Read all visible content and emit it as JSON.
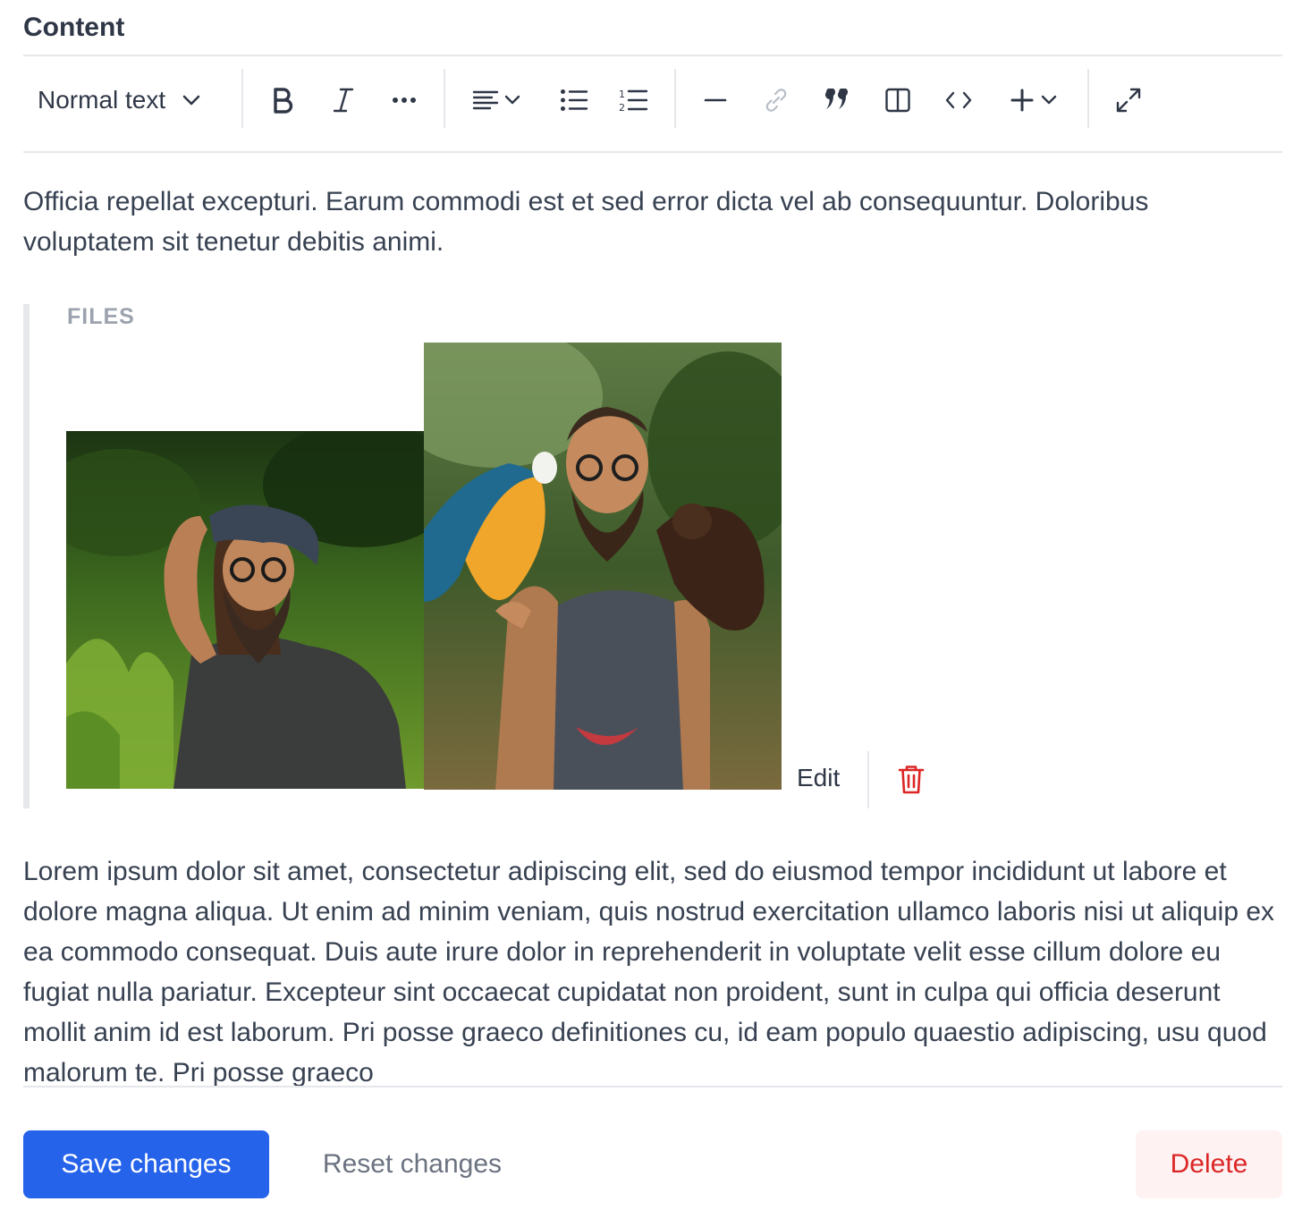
{
  "section": {
    "title": "Content"
  },
  "toolbar": {
    "text_style": "Normal text",
    "buttons": [
      {
        "name": "bold",
        "icon": "bold-icon"
      },
      {
        "name": "italic",
        "icon": "italic-icon"
      },
      {
        "name": "more-formatting",
        "icon": "more-horizontal-icon"
      },
      {
        "name": "align",
        "icon": "align-left-icon"
      },
      {
        "name": "bullet-list",
        "icon": "bullet-list-icon"
      },
      {
        "name": "numbered-list",
        "icon": "numbered-list-icon"
      },
      {
        "name": "horizontal-rule",
        "icon": "minus-icon"
      },
      {
        "name": "link",
        "icon": "link-icon",
        "disabled": true
      },
      {
        "name": "quote",
        "icon": "quote-icon"
      },
      {
        "name": "columns",
        "icon": "columns-icon"
      },
      {
        "name": "code",
        "icon": "code-icon"
      },
      {
        "name": "insert",
        "icon": "plus-icon"
      },
      {
        "name": "fullscreen",
        "icon": "expand-icon"
      }
    ]
  },
  "editor": {
    "paragraph_1": "Officia repellat excepturi. Earum commodi est et sed error dicta vel ab consequuntur. Doloribus voluptatem sit tenetur debitis animi.",
    "files_block": {
      "label": "FILES",
      "edit_label": "Edit",
      "delete_icon": "trash-icon"
    },
    "paragraph_2": "Lorem ipsum dolor sit amet, consectetur adipiscing elit, sed do eiusmod tempor incididunt ut labore et dolore magna aliqua. Ut enim ad minim veniam, quis nostrud exercitation ullamco laboris nisi ut aliquip ex ea commodo consequat. Duis aute irure dolor in reprehenderit in voluptate velit esse cillum dolore eu fugiat nulla pariatur. Excepteur sint occaecat cupidatat non proident, sunt in culpa qui officia deserunt mollit anim id est laborum. Pri posse graeco definitiones cu, id eam populo quaestio adipiscing, usu quod malorum te. Pri posse graeco"
  },
  "actions": {
    "save": "Save changes",
    "reset": "Reset changes",
    "delete": "Delete"
  },
  "colors": {
    "primary": "#2563eb",
    "danger": "#dc2626",
    "danger_bg": "#fef2f2",
    "muted": "#9ca3af",
    "border": "#e5e7eb"
  }
}
